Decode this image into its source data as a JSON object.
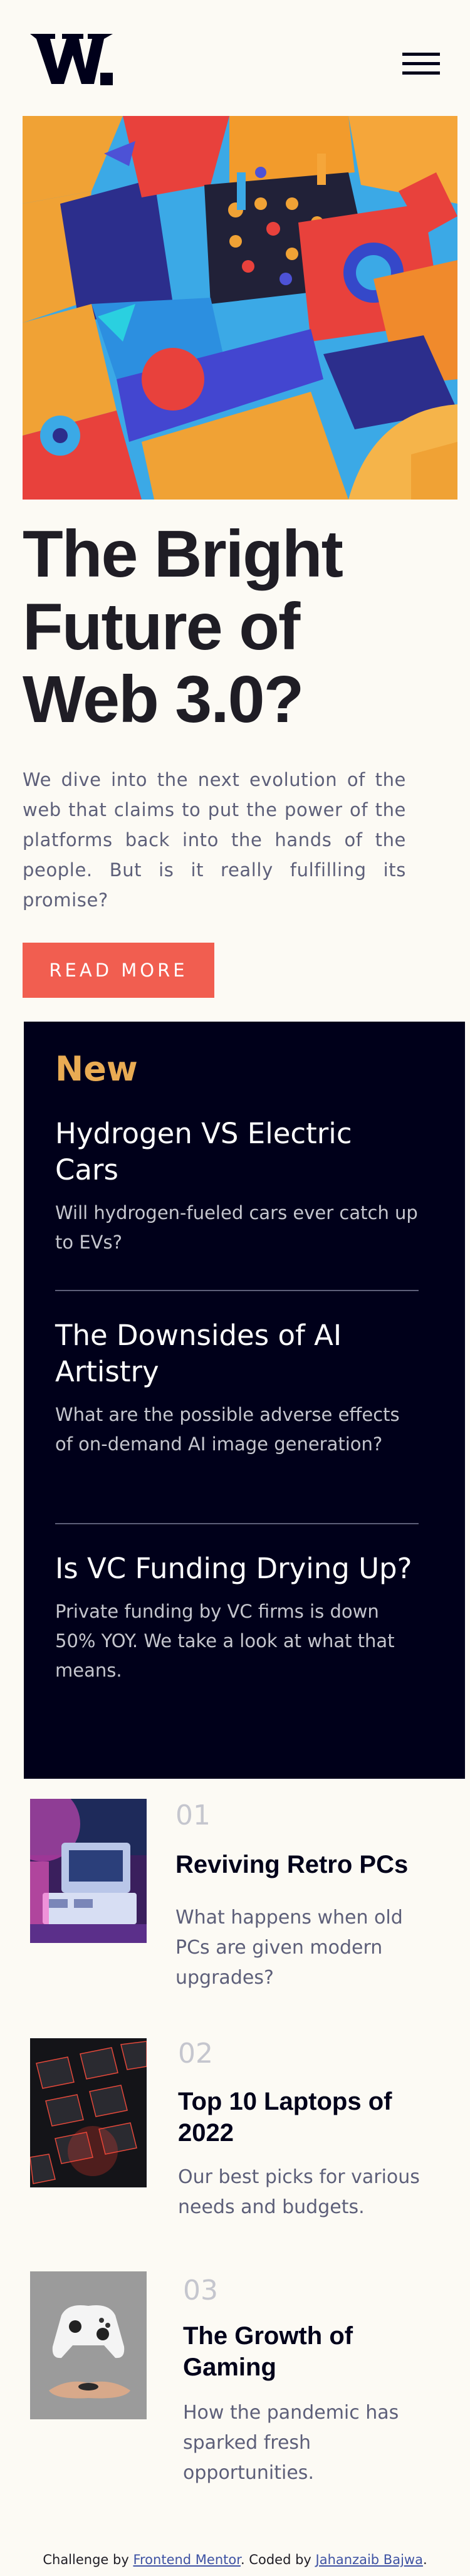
{
  "header": {
    "logo_text": "W.",
    "menu_icon": "hamburger-menu-icon"
  },
  "hero": {
    "image_alt": "Colorful 3D geometric blocks",
    "title": "The Bright Future of Web 3.0?",
    "intro": "We dive into the next evolution of the web that claims to put the power of the platforms back into the hands of the people. But is it really fulfilling its promise?",
    "button_label": "READ MORE"
  },
  "new_section": {
    "heading": "New",
    "items": [
      {
        "title": "Hydrogen VS Electric Cars",
        "desc": "Will hydrogen-fueled cars ever catch up to EVs?"
      },
      {
        "title": "The Downsides of AI Artistry",
        "desc": "What are the possible adverse effects of on-demand AI image generation?"
      },
      {
        "title": "Is VC Funding Drying Up?",
        "desc": "Private funding by VC firms is down 50% YOY. We take a look at what that means."
      }
    ]
  },
  "articles": [
    {
      "number": "01",
      "title": "Reviving Retro PCs",
      "desc": "What happens when old PCs are given modern upgrades?"
    },
    {
      "number": "02",
      "title": "Top 10 Laptops of 2022",
      "desc": "Our best picks for various needs and budgets."
    },
    {
      "number": "03",
      "title": "The Growth of Gaming",
      "desc": "How the pandemic has sparked fresh opportunities."
    }
  ],
  "footer": {
    "prefix": "Challenge by ",
    "link1": "Frontend Mentor",
    "middle": ". Coded by ",
    "link2": "Jahanzaib Bajwa",
    "suffix": "."
  },
  "colors": {
    "background": "#fcfaf4",
    "accent_red": "#f15e50",
    "accent_orange": "#e9ab53",
    "dark_navy": "#00001a",
    "grayish_blue": "#5d5f79",
    "grayish_light": "#c5c6ce"
  }
}
